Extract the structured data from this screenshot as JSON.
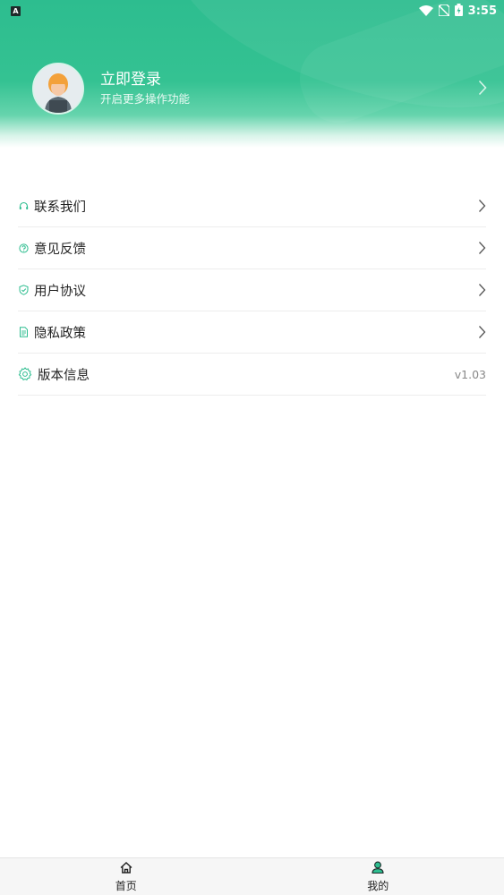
{
  "status_bar": {
    "notification_letter": "A",
    "time": "3:55"
  },
  "profile": {
    "login_title": "立即登录",
    "login_subtitle": "开启更多操作功能"
  },
  "menu": {
    "items": [
      {
        "label": "联系我们",
        "icon": "headset-icon"
      },
      {
        "label": "意见反馈",
        "icon": "question-icon"
      },
      {
        "label": "用户协议",
        "icon": "shield-check-icon"
      },
      {
        "label": "隐私政策",
        "icon": "document-icon"
      },
      {
        "label": "版本信息",
        "icon": "gear-icon",
        "value": "v1.03"
      }
    ]
  },
  "tabbar": {
    "tabs": [
      {
        "label": "首页",
        "icon": "home-icon",
        "active": false
      },
      {
        "label": "我的",
        "icon": "user-icon",
        "active": true
      }
    ]
  },
  "colors": {
    "accent": "#2dbd8f",
    "text": "#222222",
    "muted": "#888888"
  }
}
